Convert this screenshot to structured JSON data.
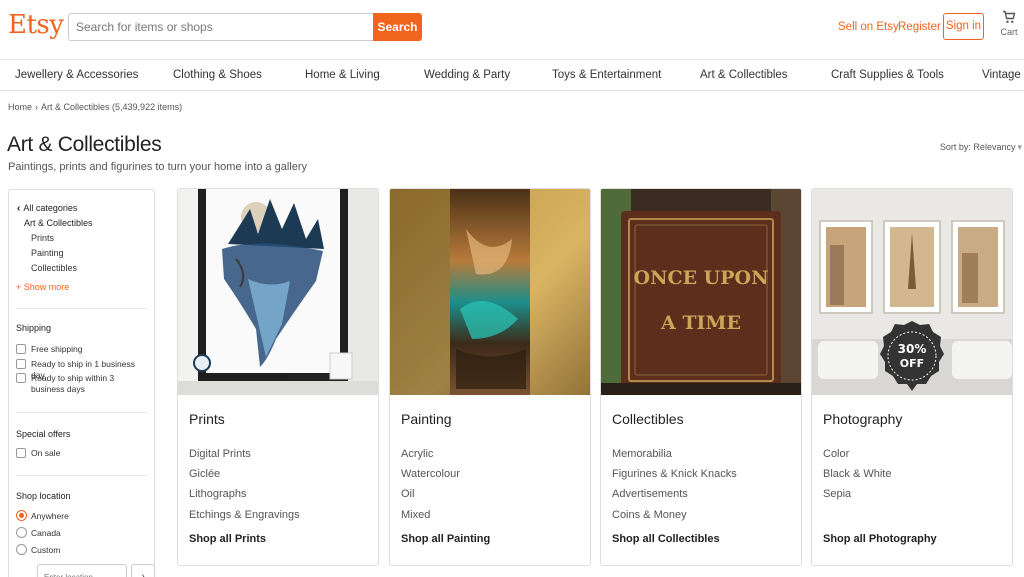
{
  "header": {
    "logo": "Etsy",
    "search_placeholder": "Search for items or shops",
    "search_button": "Search",
    "sell_link": "Sell on Etsy",
    "register_link": "Register",
    "signin_button": "Sign in",
    "cart_label": "Cart",
    "brand_color": "#f1641e"
  },
  "categories": [
    "Jewellery & Accessories",
    "Clothing & Shoes",
    "Home & Living",
    "Wedding & Party",
    "Toys & Entertainment",
    "Art & Collectibles",
    "Craft Supplies & Tools",
    "Vintage"
  ],
  "breadcrumb": {
    "home": "Home",
    "current": "Art & Collectibles (5,439,922 items)"
  },
  "page": {
    "title": "Art & Collectibles",
    "subtitle": "Paintings, prints and figurines to turn your home into a gallery",
    "sort_label": "Sort by: Relevancy"
  },
  "sidebar": {
    "all_categories": "All categories",
    "current_category": "Art & Collectibles",
    "subcategories": [
      "Prints",
      "Painting",
      "Collectibles"
    ],
    "show_more": "+ Show more",
    "shipping_heading": "Shipping",
    "shipping_options": [
      "Free shipping",
      "Ready to ship in 1 business day",
      "Ready to ship within 3 business days"
    ],
    "offers_heading": "Special offers",
    "offers_options": [
      "On sale"
    ],
    "location_heading": "Shop location",
    "location_options": [
      "Anywhere",
      "Canada",
      "Custom"
    ],
    "location_selected": "Anywhere",
    "location_placeholder": "Enter location",
    "location_go": "›"
  },
  "cards": [
    {
      "title": "Prints",
      "links": [
        "Digital Prints",
        "Giclée",
        "Lithographs",
        "Etchings & Engravings"
      ],
      "shop_all": "Shop all Prints"
    },
    {
      "title": "Painting",
      "links": [
        "Acrylic",
        "Watercolour",
        "Oil",
        "Mixed"
      ],
      "shop_all": "Shop all Painting"
    },
    {
      "title": "Collectibles",
      "links": [
        "Memorabilia",
        "Figurines & Knick Knacks",
        "Advertisements",
        "Coins & Money"
      ],
      "shop_all": "Shop all Collectibles",
      "image_text": [
        "ONCE UPON",
        "A TIME"
      ]
    },
    {
      "title": "Photography",
      "links": [
        "Color",
        "Black & White",
        "Sepia"
      ],
      "shop_all": "Shop all Photography",
      "badge": [
        "30%",
        "OFF"
      ]
    }
  ]
}
